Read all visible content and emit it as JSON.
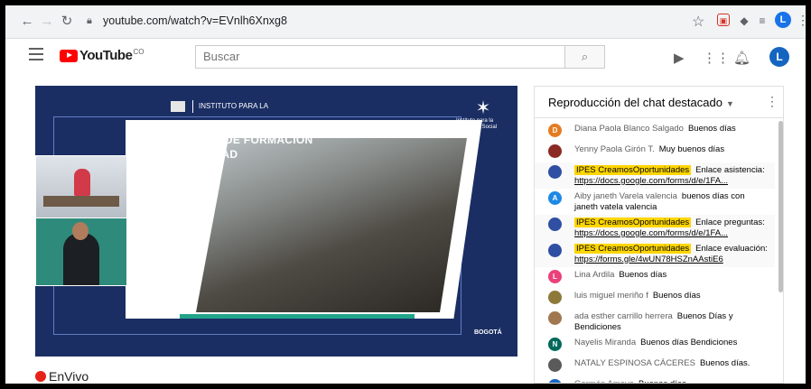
{
  "browser": {
    "url": "youtube.com/watch?v=EVnlh6Xnxg8",
    "profile_initial": "L"
  },
  "youtube": {
    "logo_text": "YouTube",
    "logo_suffix": "CO",
    "search_placeholder": "Buscar",
    "avatar_initial": "L"
  },
  "video": {
    "title_line1": "SUBDIRECCIÓN DE FORMACIÓN",
    "title_line2": "Y EMPLEABILIDAD",
    "header_text": "INSTITUTO PARA LA",
    "org_text": "Instituto para la Economía Social",
    "bogota_text": "BOGOTÁ",
    "live_label": "EnVivo"
  },
  "chat": {
    "header": "Reproducción del chat destacado",
    "messages": [
      {
        "author": "Diana Paola Blanco Salgado",
        "text": "Buenos días",
        "avatar": "D",
        "color": "#e67c22",
        "highlight": false
      },
      {
        "author": "Yenny Paola Girón T.",
        "text": "Muy buenos días",
        "avatar": "",
        "color": "#8b2a22",
        "highlight": false
      },
      {
        "author": "IPES CreamosOportunidades",
        "text": "Enlace asistencia:",
        "link": "https://docs.google.com/forms/d/e/1FA...",
        "avatar": "",
        "color": "#2f4fa3",
        "highlight": true
      },
      {
        "author": "Aiby janeth Varela valencia",
        "text": "buenos días con janeth vatela valencia",
        "avatar": "A",
        "color": "#1e88e5",
        "highlight": false
      },
      {
        "author": "IPES CreamosOportunidades",
        "text": "Enlace preguntas:",
        "link": "https://docs.google.com/forms/d/e/1FA...",
        "avatar": "",
        "color": "#2f4fa3",
        "highlight": true
      },
      {
        "author": "IPES CreamosOportunidades",
        "text": "Enlace evaluación:",
        "link": "https://forms.gle/4wUN78HSZnAAstiE6",
        "avatar": "",
        "color": "#2f4fa3",
        "highlight": true
      },
      {
        "author": "Lina Ardila",
        "text": "Buenos días",
        "avatar": "L",
        "color": "#ec407a",
        "highlight": false
      },
      {
        "author": "luis miguel meriño f",
        "text": "Buenos días",
        "avatar": "",
        "color": "#8d7a3a",
        "highlight": false
      },
      {
        "author": "ada esther carrillo herrera",
        "text": "Buenos Días y Bendiciones",
        "avatar": "",
        "color": "#a07850",
        "highlight": false
      },
      {
        "author": "Nayelis Miranda",
        "text": "Buenos días Bendiciones",
        "avatar": "N",
        "color": "#00695c",
        "highlight": false
      },
      {
        "author": "NATALY ESPINOSA CÁCERES",
        "text": "Buenos días.",
        "avatar": "",
        "color": "#5a5a5a",
        "highlight": false
      },
      {
        "author": "Germán Amaya",
        "text": "Buenos días",
        "avatar": "G",
        "color": "#1565c0",
        "highlight": false
      }
    ]
  }
}
